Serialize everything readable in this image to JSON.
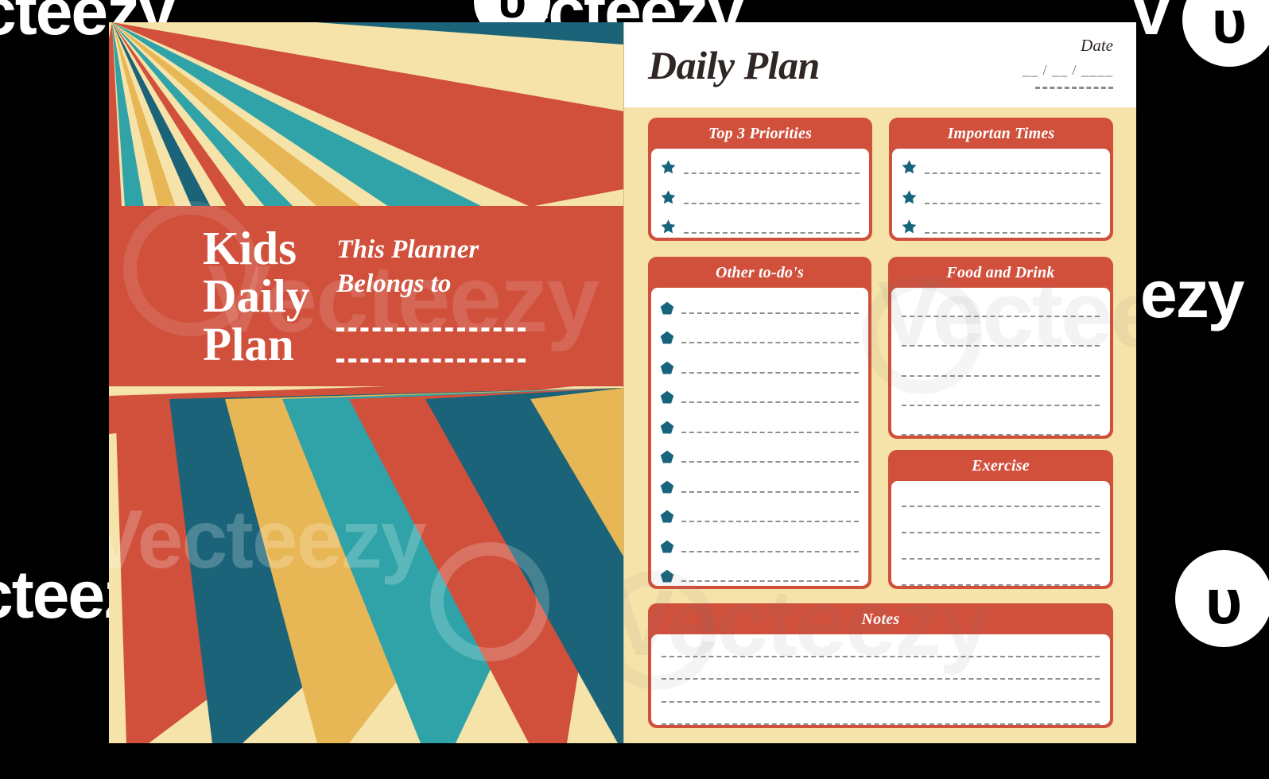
{
  "watermark": {
    "brand": "vecteezy",
    "logo_glyph": "υ",
    "fragments": {
      "top_left": "cteezy",
      "top_middle": "vecteezy",
      "top_right": "v",
      "middle_right": "ezy",
      "bottom_left": "cteezy"
    }
  },
  "cover": {
    "title": "Kids\nDaily\nPlan",
    "owner_label": "This Planner\nBelongs to",
    "owner_rules": [
      "",
      ""
    ],
    "ghost_text": "Vecteezy"
  },
  "plan": {
    "title": "Daily Plan",
    "date": {
      "label": "Date",
      "slots": "__ / __ / ____",
      "extra_rule": ""
    },
    "cards": {
      "priorities": {
        "title": "Top 3 Priorities",
        "bullet": "star-icon",
        "rows": [
          "",
          "",
          ""
        ]
      },
      "times": {
        "title": "Importan Times",
        "bullet": "star-icon",
        "rows": [
          "",
          "",
          ""
        ]
      },
      "todos": {
        "title": "Other to-do's",
        "bullet": "pentagon-icon",
        "rows": [
          "",
          "",
          "",
          "",
          "",
          "",
          "",
          "",
          "",
          ""
        ]
      },
      "food": {
        "title": "Food and Drink",
        "rows": [
          "",
          "",
          "",
          "",
          ""
        ]
      },
      "exercise": {
        "title": "Exercise",
        "rows": [
          "",
          "",
          "",
          ""
        ]
      },
      "notes": {
        "title": "Notes",
        "rows": [
          "",
          "",
          "",
          ""
        ]
      }
    },
    "ghost_text": "Vecteezy"
  },
  "colors": {
    "red": "#D0503C",
    "cream": "#F6E3A9",
    "gold": "#E8B755",
    "teal": "#2FA3A8",
    "dark_teal": "#1A6378",
    "ink": "#2E2724",
    "rule": "#8F8F8F",
    "backdrop": "#000000"
  },
  "sunburst": {
    "top_origin": "top-left",
    "bottom_origin": "top-right",
    "palette": [
      "#F6E3A9",
      "#D0503C",
      "#2FA3A8",
      "#1A6378",
      "#E8B755"
    ]
  }
}
